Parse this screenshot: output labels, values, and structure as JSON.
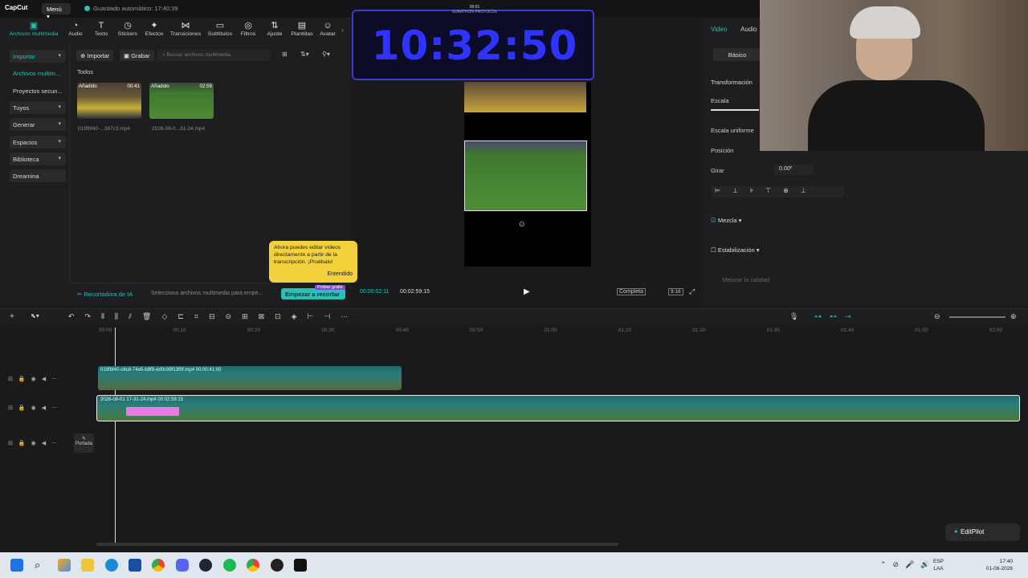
{
  "app": {
    "logo": "CapCut",
    "menu": "Menú",
    "autosave": "Guardado automático: 17:40:39"
  },
  "toolbar": [
    {
      "label": "Archivos multimedia",
      "icon": "media-icon"
    },
    {
      "label": "Audio",
      "icon": "audio-icon"
    },
    {
      "label": "Texto",
      "icon": "text-icon"
    },
    {
      "label": "Stickers",
      "icon": "sticker-icon"
    },
    {
      "label": "Efectos",
      "icon": "effects-icon"
    },
    {
      "label": "Transiciones",
      "icon": "transitions-icon"
    },
    {
      "label": "Subtítulos",
      "icon": "subtitles-icon"
    },
    {
      "label": "Filtros",
      "icon": "filters-icon"
    },
    {
      "label": "Ajuste",
      "icon": "adjust-icon"
    },
    {
      "label": "Plantillas",
      "icon": "templates-icon"
    },
    {
      "label": "Avatar",
      "icon": "avatar-icon"
    }
  ],
  "leftnav": {
    "importar": "Importar",
    "archivos": "Archivos multim...",
    "proyectos": "Proyectos secun...",
    "tuyos": "Tuyos",
    "generar": "Generar",
    "espacios": "Espacios",
    "biblioteca": "Biblioteca",
    "dreamina": "Dreamina"
  },
  "media": {
    "import_btn": "Importar",
    "record_btn": "Grabar",
    "search_placeholder": "Buscar archivos multimedia",
    "filter_all": "Todos",
    "items": [
      {
        "tag": "Añadido",
        "duration": "00:41",
        "caption": "019fbf40-...387c3.mp4"
      },
      {
        "tag": "Añadido",
        "duration": "02:59",
        "caption": "2026-08-0...31-24.mp4"
      }
    ]
  },
  "ia": {
    "label": "Recortadora de IA",
    "hint": "Selecciona archivos multimedia para empe...",
    "cut_btn": "Empezar a recortar",
    "trial": "Probar gratis"
  },
  "tooltip": {
    "text": "Ahora puedes editar vídeos directamente a partir de la transcripción. ¡Pruébalo!",
    "ok": "Entendido"
  },
  "player": {
    "current": "00:00:02:11",
    "total": "00:02:59:15",
    "complete": "Completa",
    "ratio": "9:16"
  },
  "timer": {
    "time": "10:32:50",
    "brand": "SUBATHON PROTOCOL",
    "tag": "00:01"
  },
  "right": {
    "tab_video": "Video",
    "tab_audio": "Audio",
    "basic": "Básico",
    "transform": "Transformación",
    "scale": "Escala",
    "uniform": "Escala uniforme",
    "position": "Posición",
    "rotate": "Girar",
    "rotate_val": "0.00º",
    "blend": "Mezcla",
    "stabilize": "Estabilización",
    "quality": "Mejorar la calidad"
  },
  "timeline": {
    "ticks": [
      "00:00",
      "00:10",
      "00:20",
      "00:30",
      "00:40",
      "00:50",
      "01:00",
      "01:10",
      "01:20",
      "01:30",
      "01:40",
      "01:50",
      "02:00"
    ],
    "clip1_label": "019fbf40-c6c8-74e5-b9f9-dd0c99f13f0f.mp4  00:00:41:00",
    "clip2_label": "2026-08-01 17-31-24.mp4  00:02:59:15",
    "cover": "Portada"
  },
  "editpilot": "EditPilot",
  "taskbar": {
    "lang1": "ESP",
    "lang2": "LAA",
    "time": "17:40",
    "date": "01-08-2026"
  }
}
